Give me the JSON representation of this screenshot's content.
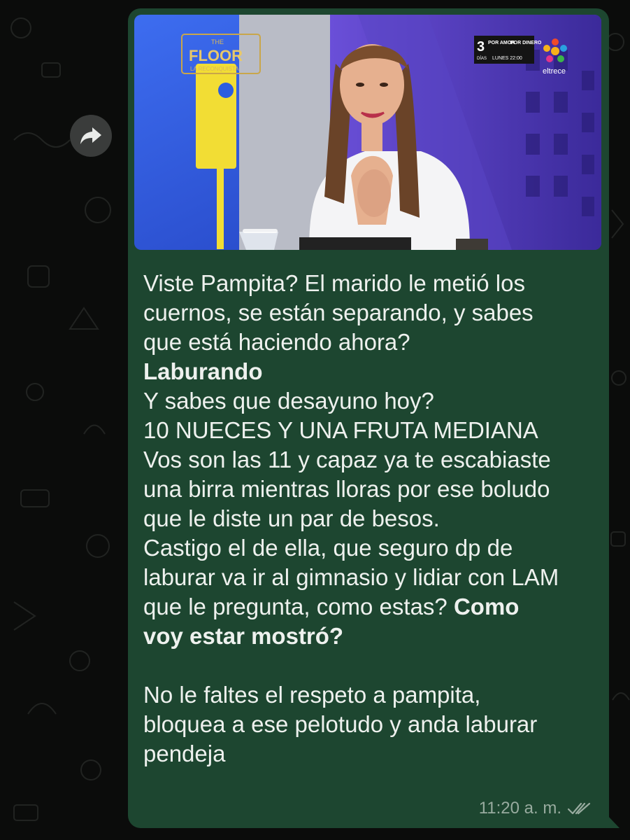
{
  "chat": {
    "bubble_color": "#1d4630",
    "background_color": "#0b0c0b",
    "forward_icon": "forward-arrow-icon",
    "media": {
      "show_logo_top": "THE",
      "show_logo_main": "FLOOR",
      "show_logo_sub": "LA RECONQUISTA",
      "channel_name": "eltrece",
      "promo_number": "3",
      "promo_days_label": "DÍAS",
      "promo_title_1": "POR AMOR",
      "promo_title_2": "POR DINERO",
      "promo_schedule": "LUNES 22:00"
    },
    "message": {
      "lines": [
        {
          "text": "Viste Pampita? El marido le metió los",
          "bold": false
        },
        {
          "text": "cuernos, se están separando, y sabes",
          "bold": false
        },
        {
          "text": "que está haciendo ahora?",
          "bold": false
        },
        {
          "text": "Laburando",
          "bold": true
        },
        {
          "text": "Y sabes que desayuno hoy?",
          "bold": false
        },
        {
          "text": "10 NUECES Y UNA FRUTA MEDIANA",
          "bold": false
        },
        {
          "text": "Vos son las 11 y capaz ya te escabiaste",
          "bold": false
        },
        {
          "text": "una birra mientras lloras por ese boludo",
          "bold": false
        },
        {
          "text": "que le diste un par de besos.",
          "bold": false
        },
        {
          "text": "Castigo el de ella, que seguro dp de",
          "bold": false
        },
        {
          "text": "laburar va ir al gimnasio y lidiar con LAM",
          "bold": false
        },
        {
          "text": "que le pregunta, como estas?",
          "bold": false,
          "bold_suffix": "Como"
        },
        {
          "text": "voy estar mostró?",
          "bold": true
        },
        {
          "text": "",
          "bold": false
        },
        {
          "text": "No le faltes el respeto a pampita,",
          "bold": false
        },
        {
          "text": "bloquea a ese pelotudo y anda laburar",
          "bold": false
        },
        {
          "text": "pendeja",
          "bold": false
        }
      ],
      "time": "11:20 a. m.",
      "status_icon": "double-check-icon"
    }
  }
}
